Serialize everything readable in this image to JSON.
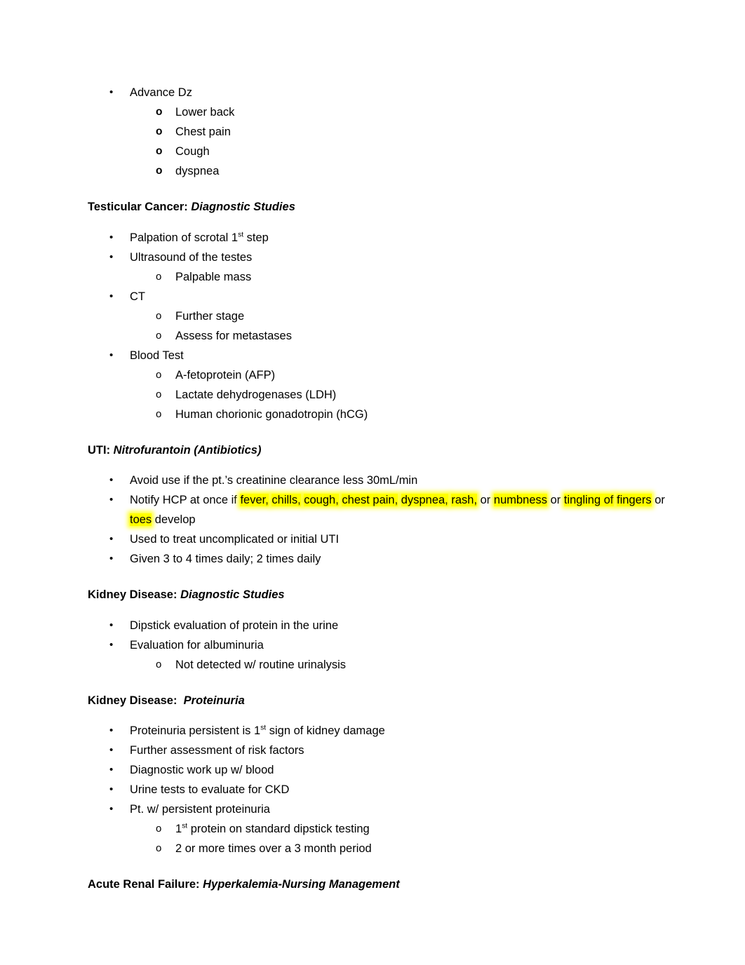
{
  "document": {
    "sections": [
      {
        "id": "advance-dz",
        "heading": null,
        "items": [
          {
            "level": 1,
            "marker": "•",
            "text": "Advance Dz"
          },
          {
            "level": 2,
            "marker": "o",
            "marker_bold": true,
            "text": "Lower back"
          },
          {
            "level": 2,
            "marker": "o",
            "marker_bold": true,
            "text": "Chest pain"
          },
          {
            "level": 2,
            "marker": "o",
            "marker_bold": true,
            "text": "Cough"
          },
          {
            "level": 2,
            "marker": "o",
            "marker_bold": true,
            "text": "dyspnea"
          }
        ]
      },
      {
        "id": "testicular-cancer",
        "heading": {
          "lead": "Testicular Cancer: ",
          "em": "Diagnostic Studies"
        },
        "items": [
          {
            "level": 1,
            "marker": "•",
            "text_pre": "Palpation of scrotal 1",
            "sup": "st",
            "text_post": " step"
          },
          {
            "level": 1,
            "marker": "•",
            "text": "Ultrasound of the testes"
          },
          {
            "level": 2,
            "marker": "o",
            "marker_bold": false,
            "text": "Palpable mass"
          },
          {
            "level": 1,
            "marker": "•",
            "text": "CT"
          },
          {
            "level": 2,
            "marker": "o",
            "marker_bold": false,
            "text": "Further stage"
          },
          {
            "level": 2,
            "marker": "o",
            "marker_bold": false,
            "text": "Assess for metastases"
          },
          {
            "level": 1,
            "marker": "•",
            "text": "Blood Test"
          },
          {
            "level": 2,
            "marker": "o",
            "marker_bold": false,
            "text": "A-fetoprotein (AFP)"
          },
          {
            "level": 2,
            "marker": "o",
            "marker_bold": false,
            "text": "Lactate dehydrogenases (LDH)"
          },
          {
            "level": 2,
            "marker": "o",
            "marker_bold": false,
            "text": "Human chorionic gonadotropin (hCG)"
          }
        ]
      },
      {
        "id": "uti-nitrofurantoin",
        "heading": {
          "lead": "UTI: ",
          "em": "Nitrofurantoin (Antibiotics)"
        },
        "items": [
          {
            "level": 1,
            "marker": "•",
            "text": "Avoid use if the pt.’s creatinine clearance less 30mL/min"
          },
          {
            "level": 1,
            "marker": "•",
            "runs": [
              {
                "text": "Notify HCP at once if ",
                "highlight": false
              },
              {
                "text": "fever,",
                "highlight": true
              },
              {
                "text": " ",
                "highlight": false
              },
              {
                "text": "chills,",
                "highlight": true
              },
              {
                "text": " ",
                "highlight": false
              },
              {
                "text": "cough,",
                "highlight": true
              },
              {
                "text": " ",
                "highlight": false
              },
              {
                "text": "chest pain,",
                "highlight": true
              },
              {
                "text": " ",
                "highlight": false
              },
              {
                "text": "dyspnea,",
                "highlight": true
              },
              {
                "text": " ",
                "highlight": false
              },
              {
                "text": "rash,",
                "highlight": true
              },
              {
                "text": " or ",
                "highlight": false
              },
              {
                "text": "numbness",
                "highlight": true
              },
              {
                "text": " or ",
                "highlight": false
              },
              {
                "text": "tingling of",
                "highlight": true
              },
              {
                "text": " ",
                "highlight": false
              },
              {
                "text": "fingers",
                "highlight": true
              },
              {
                "text": " or ",
                "highlight": false
              },
              {
                "text": "toes",
                "highlight": true
              },
              {
                "text": " develop",
                "highlight": false
              }
            ]
          },
          {
            "level": 1,
            "marker": "•",
            "text": "Used to treat uncomplicated or initial UTI"
          },
          {
            "level": 1,
            "marker": "•",
            "text": "Given 3 to 4 times daily; 2 times daily"
          }
        ]
      },
      {
        "id": "kidney-disease-diagnostic",
        "heading": {
          "lead": "Kidney Disease: ",
          "em": "Diagnostic Studies"
        },
        "items": [
          {
            "level": 1,
            "marker": "•",
            "text": "Dipstick evaluation of protein in the urine"
          },
          {
            "level": 1,
            "marker": "•",
            "text": "Evaluation for albuminuria"
          },
          {
            "level": 2,
            "marker": "o",
            "marker_bold": false,
            "text": "Not detected w/ routine urinalysis"
          }
        ]
      },
      {
        "id": "kidney-disease-proteinuria",
        "heading": {
          "lead": "Kidney Disease:  ",
          "em": "Proteinuria"
        },
        "items": [
          {
            "level": 1,
            "marker": "•",
            "text_pre": "Proteinuria persistent is 1",
            "sup": "st",
            "text_post": " sign of kidney damage"
          },
          {
            "level": 1,
            "marker": "•",
            "text": "Further assessment of risk factors"
          },
          {
            "level": 1,
            "marker": "•",
            "text": "Diagnostic work up w/ blood"
          },
          {
            "level": 1,
            "marker": "•",
            "text": "Urine tests to evaluate for CKD"
          },
          {
            "level": 1,
            "marker": "•",
            "text": "Pt. w/ persistent proteinuria"
          },
          {
            "level": 2,
            "marker": "o",
            "marker_bold": false,
            "text_pre": "1",
            "sup": "st",
            "text_post": " protein on standard dipstick testing"
          },
          {
            "level": 2,
            "marker": "o",
            "marker_bold": false,
            "text": "2 or more times over a 3 month period"
          }
        ]
      },
      {
        "id": "acute-renal-failure",
        "heading": {
          "lead": "Acute Renal Failure: ",
          "em": "Hyperkalemia-Nursing Management"
        },
        "items": []
      }
    ]
  },
  "colors": {
    "highlight": "#ffff00",
    "text": "#000000",
    "background": "#ffffff"
  }
}
